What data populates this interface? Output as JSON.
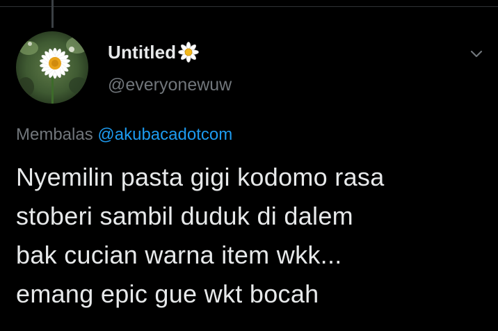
{
  "tweet": {
    "author": {
      "display_name": "Untitled",
      "name_emoji": "daisy-flower-icon",
      "handle": "@everyonewuw",
      "avatar": "daisy-photo"
    },
    "reply_prefix": "Membalas",
    "reply_to": "@akubacadotcom",
    "text_lines": [
      "Nyemilin pasta gigi kodomo rasa",
      "stoberi sambil duduk di dalem",
      "bak cucian warna item wkk...",
      "emang epic gue wkt bocah"
    ],
    "menu_icon": "chevron-down-icon"
  },
  "colors": {
    "background": "#000000",
    "primary_text": "#e7e9ea",
    "secondary_text": "#71767b",
    "link": "#1d9bf0"
  }
}
